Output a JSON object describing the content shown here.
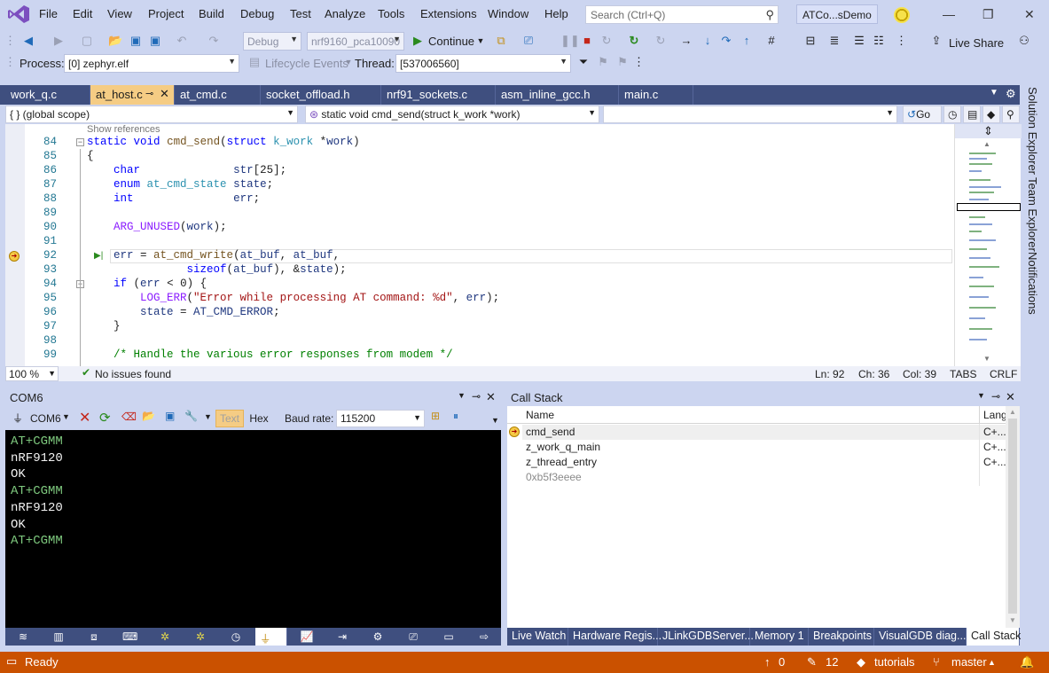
{
  "menu": {
    "items": [
      "File",
      "Edit",
      "View",
      "Project",
      "Build",
      "Debug",
      "Test",
      "Analyze",
      "Tools",
      "Extensions",
      "Window",
      "Help"
    ],
    "search_placeholder": "Search (Ctrl+Q)",
    "solution_name": "ATCo...sDemo"
  },
  "toolbar": {
    "config": "Debug",
    "platform": "nrf9160_pca10090",
    "continue_label": "Continue",
    "live_share": "Live Share",
    "process_label": "Process:",
    "process_value": "[0] zephyr.elf",
    "lifecycle_label": "Lifecycle Events",
    "thread_label": "Thread:",
    "thread_value": "[537006560]"
  },
  "editor": {
    "tabs": [
      "work_q.c",
      "at_host.c",
      "at_cmd.c",
      "socket_offload.h",
      "nrf91_sockets.c",
      "asm_inline_gcc.h",
      "main.c"
    ],
    "active_tab": "at_host.c",
    "scope": "{ } (global scope)",
    "function": "static void cmd_send(struct k_work *work)",
    "go_label": "Go",
    "show_references": "Show references",
    "line_numbers": [
      "84",
      "85",
      "86",
      "87",
      "88",
      "89",
      "90",
      "91",
      "92",
      "93",
      "94",
      "95",
      "96",
      "97",
      "98",
      "99"
    ],
    "zoom": "100 %",
    "issues": "No issues found",
    "ln": "Ln: 92",
    "ch": "Ch: 36",
    "col": "Col: 39",
    "tabs_mode": "TABS",
    "eol": "CRLF"
  },
  "side_tabs": [
    "Solution Explorer",
    "Team Explorer",
    "Notifications"
  ],
  "com_panel": {
    "title": "COM6",
    "port": "COM6",
    "text_mode": "Text",
    "hex_mode": "Hex",
    "baud_label": "Baud rate:",
    "baud_value": "115200",
    "lines": [
      "AT+CGMM",
      "nRF9120",
      "OK",
      "AT+CGMM",
      "nRF9120",
      "OK",
      "AT+CGMM"
    ]
  },
  "call_stack": {
    "title": "Call Stack",
    "col_name": "Name",
    "col_lang": "Lang",
    "rows": [
      {
        "name": "cmd_send",
        "lang": "C+..."
      },
      {
        "name": "z_work_q_main",
        "lang": "C+..."
      },
      {
        "name": "z_thread_entry",
        "lang": "C+..."
      },
      {
        "name": "0xb5f3eeee",
        "lang": ""
      }
    ]
  },
  "bottom_tabs": [
    "Live Watch",
    "Hardware Regis...",
    "JLinkGDBServer...",
    "Memory 1",
    "Breakpoints",
    "VisualGDB diag...",
    "Call Stack"
  ],
  "status": {
    "ready": "Ready",
    "up_count": "0",
    "edit_count": "12",
    "repo": "tutorials",
    "branch": "master"
  },
  "colors": {
    "accent": "#ca5100",
    "chrome": "#ccd5f0",
    "tabbar": "#3f4f7f",
    "active_tab": "#f5cc84",
    "terminal_green": "#7ec97e"
  }
}
